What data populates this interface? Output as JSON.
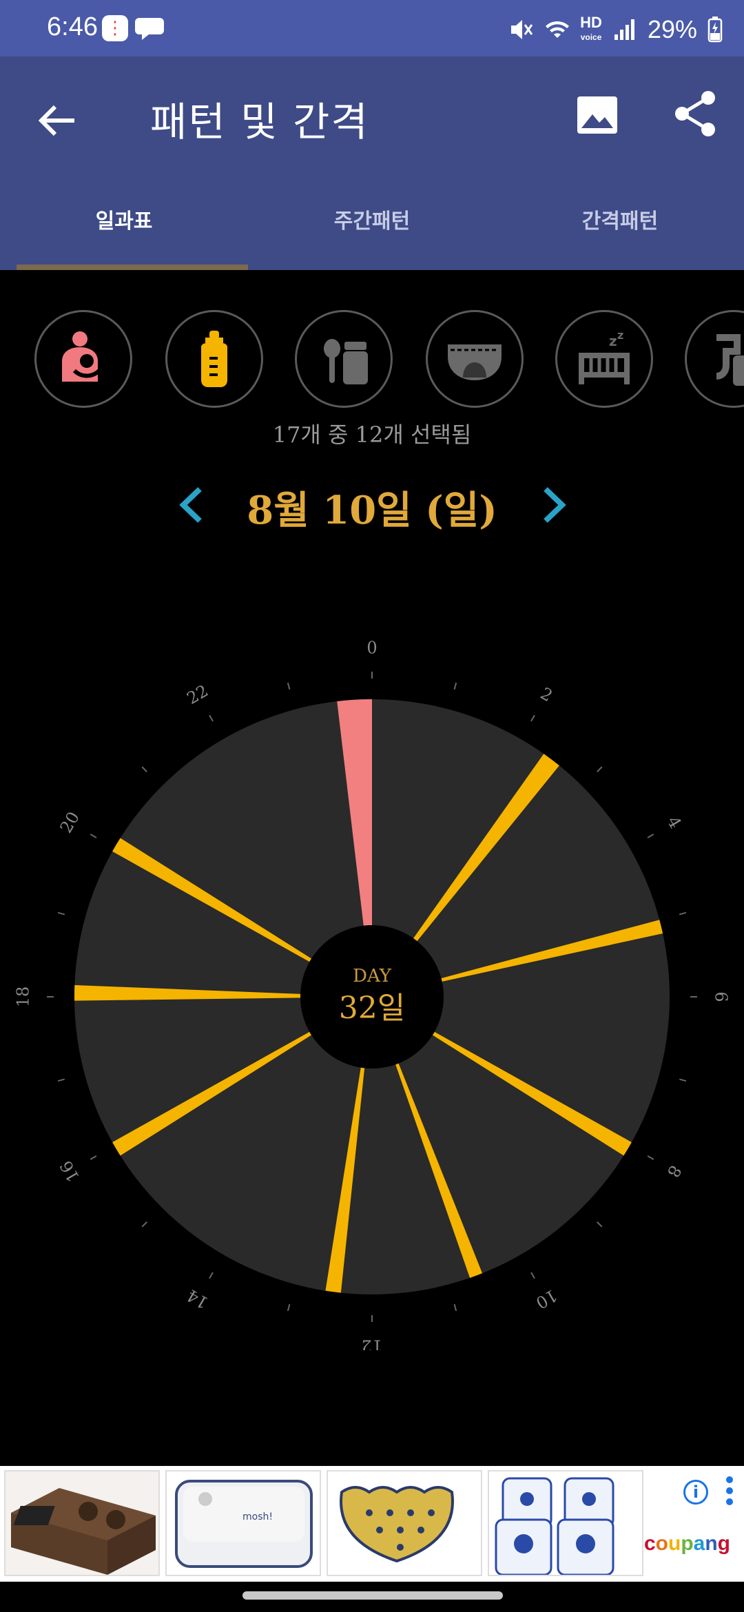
{
  "status_bar": {
    "time": "6:46",
    "network": "HD",
    "network_sub": "voice",
    "battery": "29%"
  },
  "app_bar": {
    "title": "패턴 및 간격"
  },
  "tabs": [
    {
      "label": "일과표",
      "active": true
    },
    {
      "label": "주간패턴",
      "active": false
    },
    {
      "label": "간격패턴",
      "active": false
    }
  ],
  "categories": [
    {
      "icon": "breastfeeding-icon",
      "color": "#f07a80"
    },
    {
      "icon": "baby-bottle-icon",
      "color": "#f5b400"
    },
    {
      "icon": "baby-food-icon",
      "color": "#6a6a6a"
    },
    {
      "icon": "diaper-icon",
      "color": "#6a6a6a"
    },
    {
      "icon": "crib-sleep-icon",
      "color": "#6a6a6a"
    },
    {
      "icon": "pump-icon",
      "color": "#6a6a6a"
    }
  ],
  "selection_count": "17개 중 12개 선택됨",
  "date_label": "8월 10일 (일)",
  "center": {
    "line1": "DAY",
    "line2": "32일"
  },
  "chart_data": {
    "type": "radial-timeline",
    "hour_labels": [
      "0",
      "2",
      "4",
      "6",
      "8",
      "10",
      "12",
      "14",
      "16",
      "18",
      "20",
      "22"
    ],
    "events": [
      {
        "category": "breastfeeding",
        "color": "#f28080",
        "start_hour": 23.55,
        "end_hour": 0.0
      },
      {
        "category": "bottle",
        "color": "#f5b400",
        "start_hour": 2.35,
        "end_hour": 2.6
      },
      {
        "category": "bottle",
        "color": "#f5b400",
        "start_hour": 5.0,
        "end_hour": 5.18
      },
      {
        "category": "bottle",
        "color": "#f5b400",
        "start_hour": 7.95,
        "end_hour": 8.15
      },
      {
        "category": "bottle",
        "color": "#f5b400",
        "start_hour": 10.55,
        "end_hour": 10.72
      },
      {
        "category": "bottle",
        "color": "#f5b400",
        "start_hour": 12.4,
        "end_hour": 12.6
      },
      {
        "category": "bottle",
        "color": "#f5b400",
        "start_hour": 15.85,
        "end_hour": 16.05
      },
      {
        "category": "bottle",
        "color": "#f5b400",
        "start_hour": 17.95,
        "end_hour": 18.15
      },
      {
        "category": "bottle",
        "color": "#f5b400",
        "start_hour": 19.95,
        "end_hour": 20.15
      }
    ]
  },
  "ad": {
    "brand": "coupang",
    "info_label": "i",
    "products": [
      "knock-box-product",
      "lunchbox-product",
      "bowl-product",
      "glasses-product"
    ]
  }
}
